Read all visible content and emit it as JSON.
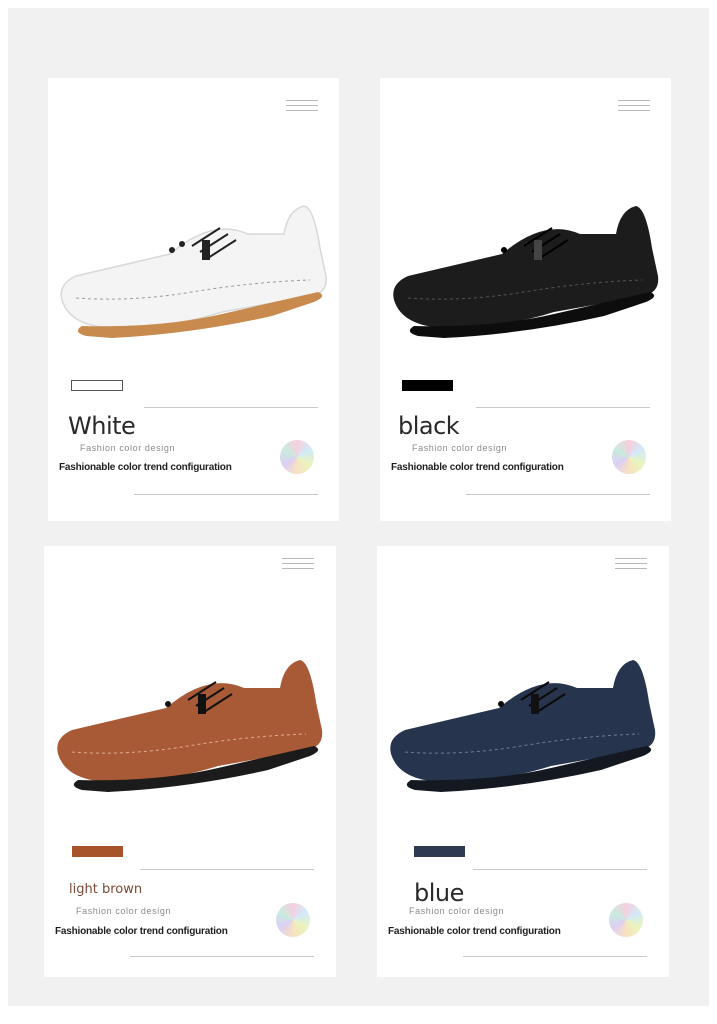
{
  "cards": [
    {
      "color_name": "White",
      "subtitle": "Fashion color design",
      "tagline": "Fashionable color trend configuration",
      "swatch_color": "#ffffff",
      "shoe_color": "#f4f4f4",
      "sole_color": "#c98a4e"
    },
    {
      "color_name": "black",
      "subtitle": "Fashion color design",
      "tagline": "Fashionable color trend configuration",
      "swatch_color": "#000000",
      "shoe_color": "#1c1c1c",
      "sole_color": "#0d0d0d"
    },
    {
      "color_name": "light brown",
      "subtitle": "Fashion color design",
      "tagline": "Fashionable color trend configuration",
      "swatch_color": "#a8542a",
      "shoe_color": "#a85a36",
      "sole_color": "#1b1b1b"
    },
    {
      "color_name": "blue",
      "subtitle": "Fashion color design",
      "tagline": "Fashionable color trend configuration",
      "swatch_color": "#2e3a4f",
      "shoe_color": "#27344d",
      "sole_color": "#141821"
    }
  ]
}
